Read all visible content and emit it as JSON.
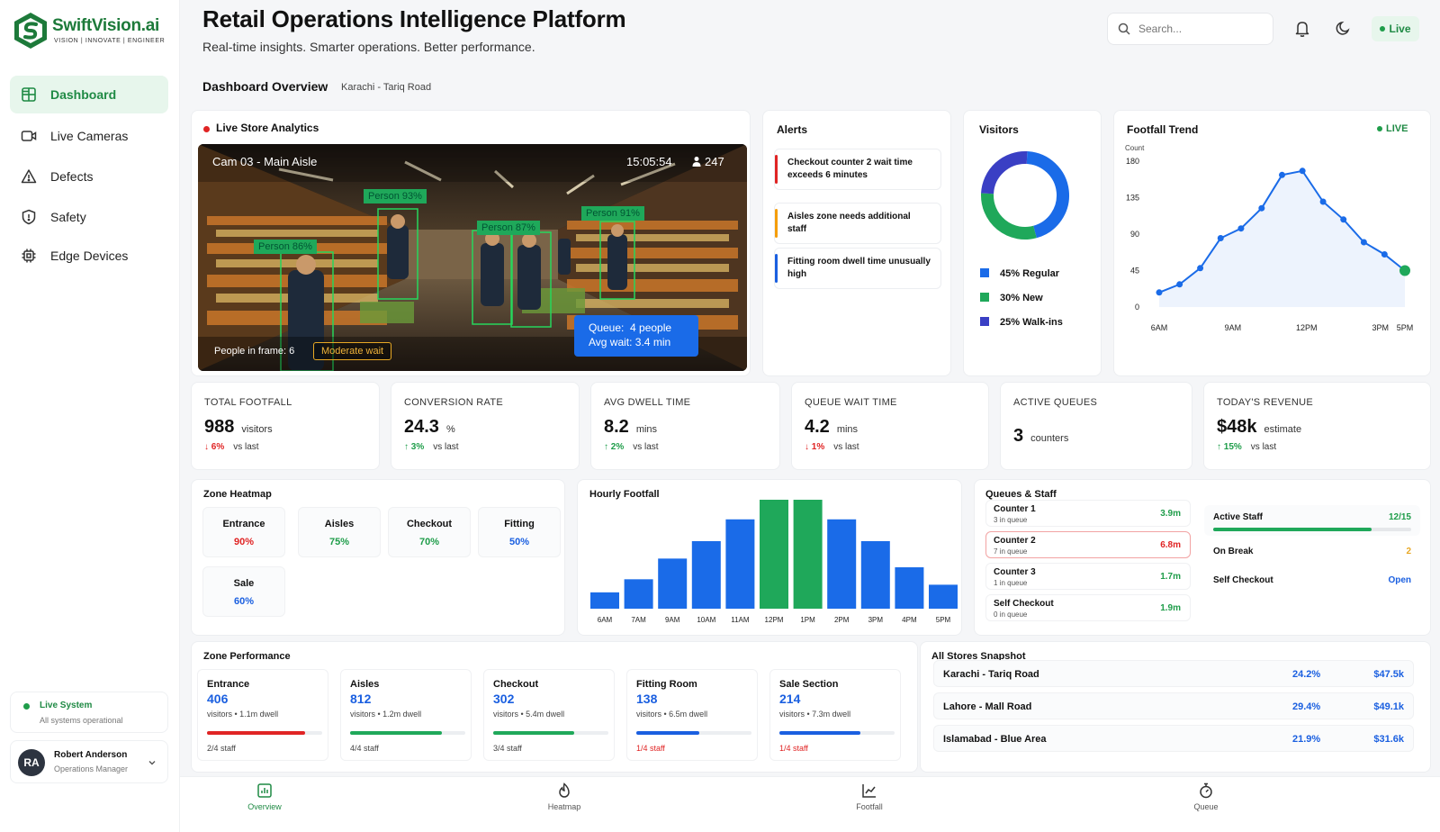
{
  "brand": {
    "name": "SwiftVision.ai",
    "tagline": "VISION | INNOVATE | ENGINEER",
    "color": "#1d7a3a"
  },
  "header": {
    "title": "Retail Operations Intelligence Platform",
    "subtitle": "Real-time insights. Smarter operations. Better performance.",
    "search_placeholder": "Search...",
    "live_label": "Live"
  },
  "sidebar": {
    "items": [
      {
        "label": "Dashboard",
        "icon": "dashboard-grid-icon",
        "active": true
      },
      {
        "label": "Live Cameras",
        "icon": "camera-icon"
      },
      {
        "label": "Defects",
        "icon": "warning-triangle-icon"
      },
      {
        "label": "Safety",
        "icon": "shield-icon"
      },
      {
        "label": "Edge Devices",
        "icon": "chip-icon"
      }
    ],
    "system": {
      "label": "Live System",
      "status": "All systems operational"
    },
    "user": {
      "initials": "RA",
      "name": "Robert Anderson",
      "role": "Operations Manager"
    }
  },
  "overview": {
    "title": "Dashboard Overview",
    "location": "Karachi - Tariq Road"
  },
  "live_analytics": {
    "title": "Live Store Analytics",
    "camera": "Cam 03 - Main Aisle",
    "time": "15:05:54",
    "count": "247",
    "detections": [
      "Person 93%",
      "Person 87%",
      "Person 91%",
      "Person 86%"
    ],
    "people_in_frame": "People in frame: 6",
    "wait_badge": "Moderate wait",
    "queue": "Queue:  4 people",
    "avg_wait": "Avg wait: 3.4 min"
  },
  "alerts": {
    "title": "Alerts",
    "items": [
      {
        "text": "Checkout counter 2 wait time exceeds 6 minutes",
        "color": "#e02424"
      },
      {
        "text": "Aisles zone needs additional staff",
        "color": "#f59e0b"
      },
      {
        "text": "Fitting room dwell time unusually high",
        "color": "#1a5fe0"
      }
    ]
  },
  "visitors": {
    "title": "Visitors",
    "segments": [
      {
        "label": "45% Regular",
        "value": 45,
        "color": "#1a6be8"
      },
      {
        "label": "30% New",
        "value": 30,
        "color": "#1fa85a"
      },
      {
        "label": "25% Walk-ins",
        "value": 25,
        "color": "#3a3fc4"
      }
    ]
  },
  "footfall_trend": {
    "title": "Footfall Trend",
    "live": "LIVE",
    "chart_data": {
      "type": "line",
      "ylabel": "Count",
      "ylim": [
        0,
        180
      ],
      "yticks": [
        0,
        45,
        90,
        135,
        180
      ],
      "xticks": [
        "6AM",
        "9AM",
        "12PM",
        "3PM",
        "5PM"
      ],
      "x": [
        6,
        6.83,
        7.67,
        8.5,
        9.33,
        10.17,
        11,
        11.83,
        12.67,
        13.5,
        14.33,
        15.17,
        16
      ],
      "values": [
        18,
        28,
        48,
        85,
        97,
        122,
        163,
        168,
        130,
        108,
        80,
        65,
        45
      ]
    }
  },
  "kpis": [
    {
      "label": "TOTAL FOOTFALL",
      "value": "988",
      "unit": "visitors",
      "delta": "6%",
      "dir": "down",
      "vs": "vs last"
    },
    {
      "label": "CONVERSION RATE",
      "value": "24.3",
      "unit": "%",
      "delta": "3%",
      "dir": "up",
      "vs": "vs last"
    },
    {
      "label": "AVG DWELL TIME",
      "value": "8.2",
      "unit": "mins",
      "delta": "2%",
      "dir": "up",
      "vs": "vs last"
    },
    {
      "label": "QUEUE WAIT TIME",
      "value": "4.2",
      "unit": "mins",
      "delta": "1%",
      "dir": "down",
      "vs": "vs last"
    },
    {
      "label": "ACTIVE QUEUES",
      "value": "3",
      "unit": "counters",
      "delta": "",
      "dir": "",
      "vs": ""
    },
    {
      "label": "TODAY'S REVENUE",
      "value": "$48k",
      "unit": "estimate",
      "delta": "15%",
      "dir": "up",
      "vs": "vs last"
    }
  ],
  "zone_heatmap": {
    "title": "Zone Heatmap",
    "zones": [
      {
        "name": "Entrance",
        "value": "90%",
        "color": "#e02424"
      },
      {
        "name": "Aisles",
        "value": "75%",
        "color": "#1f9d4a"
      },
      {
        "name": "Checkout",
        "value": "70%",
        "color": "#1f9d4a"
      },
      {
        "name": "Fitting",
        "value": "50%",
        "color": "#1a5fe0"
      },
      {
        "name": "Sale",
        "value": "60%",
        "color": "#1a5fe0"
      }
    ]
  },
  "hourly_footfall": {
    "title": "Hourly Footfall",
    "chart_data": {
      "type": "bar",
      "categories": [
        "6AM",
        "7AM",
        "9AM",
        "10AM",
        "11AM",
        "12PM",
        "1PM",
        "2PM",
        "3PM",
        "4PM",
        "5PM"
      ],
      "values": [
        15,
        27,
        46,
        62,
        82,
        100,
        100,
        82,
        62,
        38,
        22
      ],
      "highlight": [
        "12PM",
        "1PM"
      ],
      "color": "#1a6be8",
      "highlight_color": "#1fa85a"
    }
  },
  "queues_staff": {
    "title": "Queues & Staff",
    "counters": [
      {
        "name": "Counter 1",
        "sub": "3 in queue",
        "time": "3.9m",
        "color": "#1f9d4a",
        "alert": false
      },
      {
        "name": "Counter 2",
        "sub": "7 in queue",
        "time": "6.8m",
        "color": "#e02424",
        "alert": true
      },
      {
        "name": "Counter 3",
        "sub": "1 in queue",
        "time": "1.7m",
        "color": "#1f9d4a",
        "alert": false
      },
      {
        "name": "Self Checkout",
        "sub": "0 in queue",
        "time": "1.9m",
        "color": "#1f9d4a",
        "alert": false
      }
    ],
    "staff": {
      "active_label": "Active Staff",
      "active_value": "12/15",
      "active_fraction": 0.8,
      "break_label": "On Break",
      "break_value": "2",
      "self_label": "Self Checkout",
      "self_value": "Open"
    }
  },
  "zone_performance": {
    "title": "Zone Performance",
    "zones": [
      {
        "name": "Entrance",
        "visitors": "406",
        "sub": "visitors • 1.1m dwell",
        "fill": 0.85,
        "color": "#e02424",
        "staff": "2/4 staff",
        "staff_color": "#444"
      },
      {
        "name": "Aisles",
        "visitors": "812",
        "sub": "visitors • 1.2m dwell",
        "fill": 0.8,
        "color": "#1fa85a",
        "staff": "4/4 staff",
        "staff_color": "#444"
      },
      {
        "name": "Checkout",
        "visitors": "302",
        "sub": "visitors • 5.4m dwell",
        "fill": 0.7,
        "color": "#1fa85a",
        "staff": "3/4 staff",
        "staff_color": "#444"
      },
      {
        "name": "Fitting Room",
        "visitors": "138",
        "sub": "visitors • 6.5m dwell",
        "fill": 0.55,
        "color": "#1a5fe0",
        "staff": "1/4 staff",
        "staff_color": "#e02424"
      },
      {
        "name": "Sale Section",
        "visitors": "214",
        "sub": "visitors • 7.3m dwell",
        "fill": 0.7,
        "color": "#1a5fe0",
        "staff": "1/4 staff",
        "staff_color": "#e02424"
      }
    ]
  },
  "stores": {
    "title": "All Stores Snapshot",
    "rows": [
      {
        "name": "Karachi - Tariq Road",
        "conv": "24.2%",
        "rev": "$47.5k"
      },
      {
        "name": "Lahore - Mall Road",
        "conv": "29.4%",
        "rev": "$49.1k"
      },
      {
        "name": "Islamabad - Blue Area",
        "conv": "21.9%",
        "rev": "$31.6k"
      }
    ]
  },
  "bottom_nav": [
    {
      "label": "Overview",
      "icon": "bar-chart-icon",
      "active": true
    },
    {
      "label": "Heatmap",
      "icon": "flame-icon"
    },
    {
      "label": "Footfall",
      "icon": "trend-line-icon"
    },
    {
      "label": "Queue",
      "icon": "stopwatch-icon"
    }
  ]
}
